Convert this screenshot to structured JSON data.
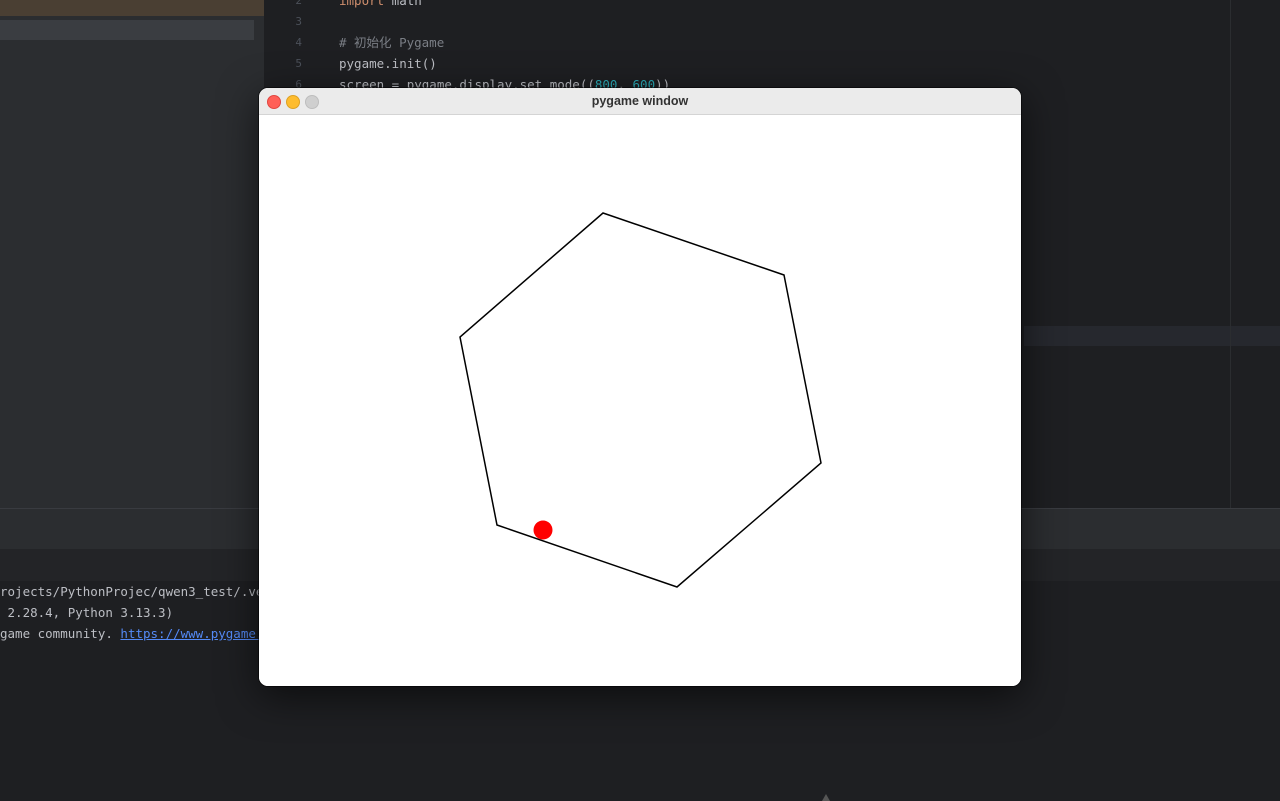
{
  "editor": {
    "line_numbers": [
      "2",
      "3",
      "4",
      "5",
      "6"
    ],
    "lines": [
      {
        "kw": "import",
        "rest": " math"
      },
      {
        "comment": "# 初始化 Pygame"
      },
      {
        "text": "pygame.init()"
      },
      {
        "pre": "screen = pygame.display.set_mode((",
        "n1": "800",
        "sep": ", ",
        "n2": "600",
        "post": "))"
      }
    ]
  },
  "terminal": {
    "lines": [
      "rojects/PythonProjec/qwen3_test/.ve",
      " 2.28.4, Python 3.13.3)"
    ],
    "community_text": "game community. ",
    "link_text": "https://www.pygame."
  },
  "window": {
    "title": "pygame window",
    "buttons": {
      "close": "close-button",
      "minimize": "minimize-button",
      "maximize": "maximize-button"
    }
  },
  "colors": {
    "ball": "#ff0000",
    "hexagon_stroke": "#000000",
    "canvas_bg": "#ffffff",
    "ide_bg": "#1e1f22"
  }
}
